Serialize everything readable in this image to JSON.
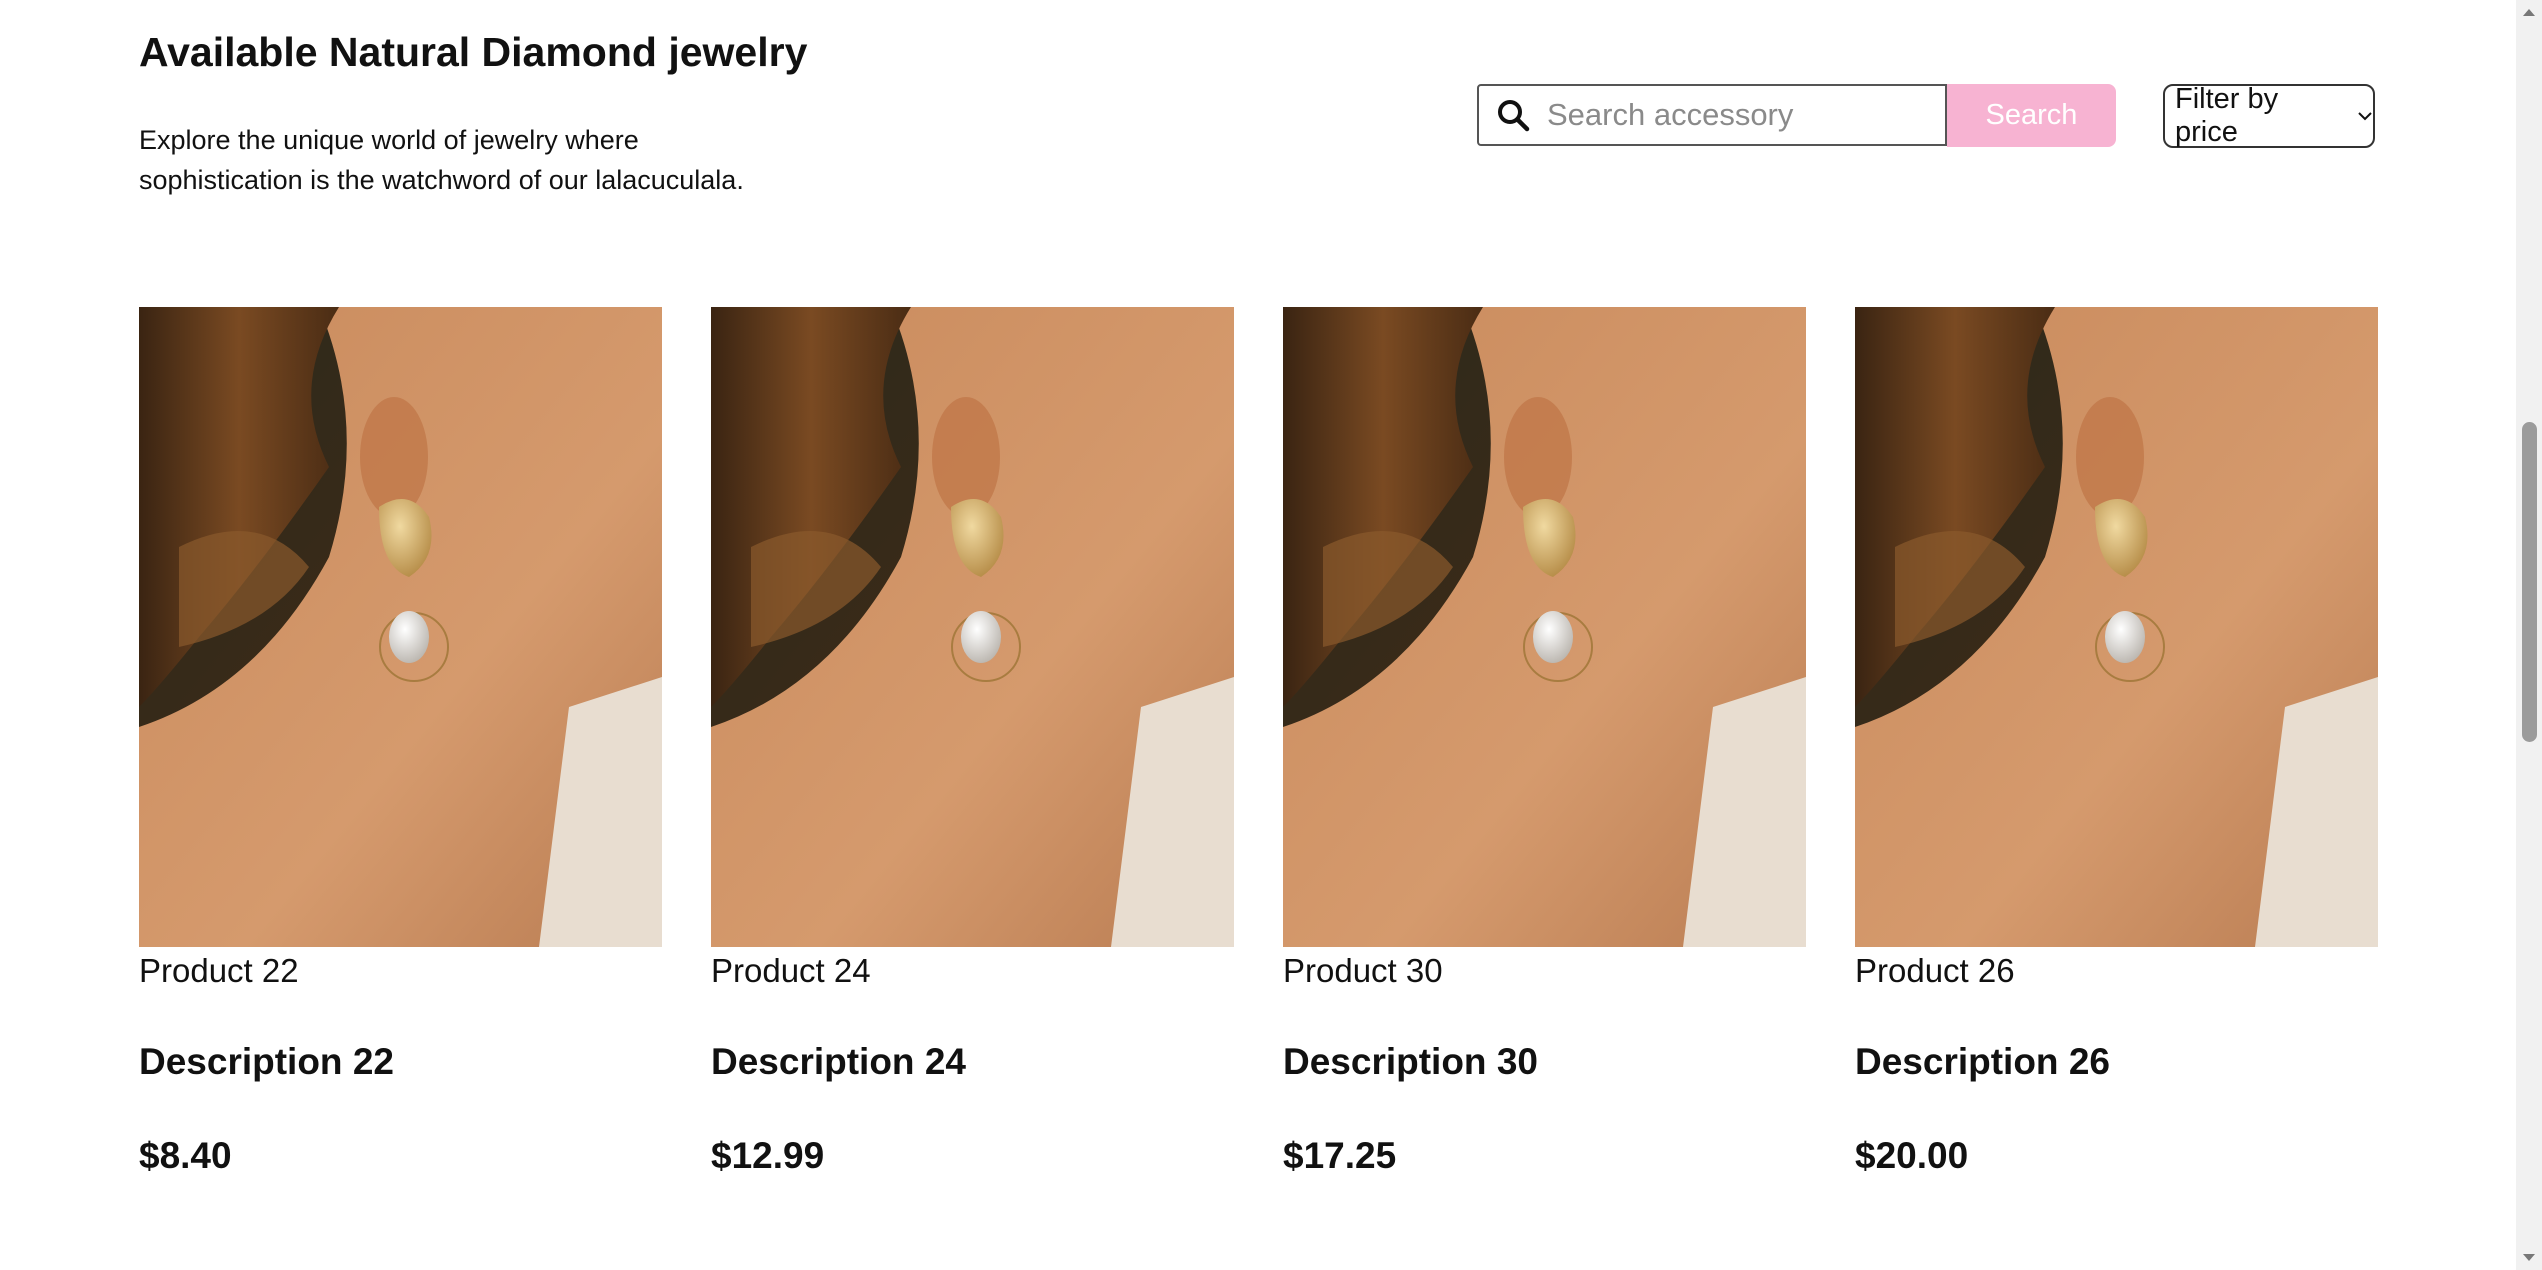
{
  "header": {
    "title": "Available Natural Diamond jewelry",
    "intro_line1": "Explore the unique world of jewelry where",
    "intro_line2": "sophistication is the watchword of our lalacuculala."
  },
  "search": {
    "placeholder": "Search accessory",
    "value": "",
    "button_label": "Search",
    "icon": "search-icon"
  },
  "filter": {
    "selected": "Filter by price",
    "icon": "chevron-down-icon"
  },
  "products": [
    {
      "name": "Product 22",
      "description": "Description 22",
      "price": "$8.40"
    },
    {
      "name": "Product 24",
      "description": "Description 24",
      "price": "$12.99"
    },
    {
      "name": "Product 30",
      "description": "Description 30",
      "price": "$17.25"
    },
    {
      "name": "Product 26",
      "description": "Description 26",
      "price": "$20.00"
    }
  ],
  "colors": {
    "accent": "#f7b3d2",
    "text": "#111111",
    "background": "#ffffff"
  }
}
